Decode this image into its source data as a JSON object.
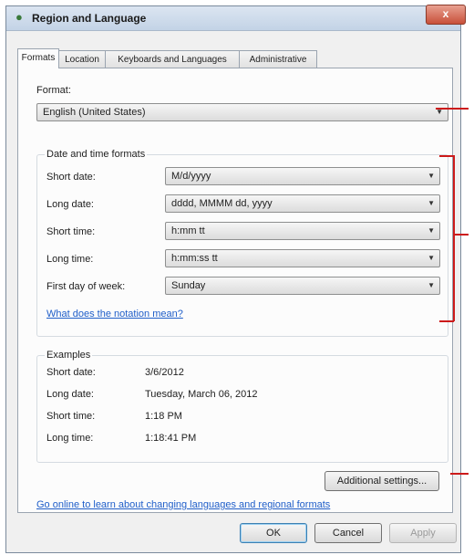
{
  "window": {
    "title": "Region and Language",
    "close_label": "x"
  },
  "tabs": [
    {
      "label": "Formats",
      "active": true
    },
    {
      "label": "Location",
      "active": false
    },
    {
      "label": "Keyboards and Languages",
      "active": false
    },
    {
      "label": "Administrative",
      "active": false
    }
  ],
  "format": {
    "label": "Format:",
    "value": "English (United States)"
  },
  "date_time_formats": {
    "group_title": "Date and time formats",
    "rows": [
      {
        "label": "Short date:",
        "value": "M/d/yyyy"
      },
      {
        "label": "Long date:",
        "value": "dddd, MMMM dd, yyyy"
      },
      {
        "label": "Short time:",
        "value": "h:mm tt"
      },
      {
        "label": "Long time:",
        "value": "h:mm:ss tt"
      },
      {
        "label": "First day of week:",
        "value": "Sunday"
      }
    ],
    "notation_link": "What does the notation mean?"
  },
  "examples": {
    "group_title": "Examples",
    "rows": [
      {
        "label": "Short date:",
        "value": "3/6/2012"
      },
      {
        "label": "Long date:",
        "value": "Tuesday, March 06, 2012"
      },
      {
        "label": "Short time:",
        "value": "1:18 PM"
      },
      {
        "label": "Long time:",
        "value": "1:18:41 PM"
      }
    ]
  },
  "additional_settings_label": "Additional settings...",
  "online_link": "Go online to learn about changing languages and regional formats",
  "footer": {
    "ok_label": "OK",
    "cancel_label": "Cancel",
    "apply_label": "Apply"
  },
  "colors": {
    "callout": "#cc1a1a",
    "link": "#1f5ec9"
  }
}
